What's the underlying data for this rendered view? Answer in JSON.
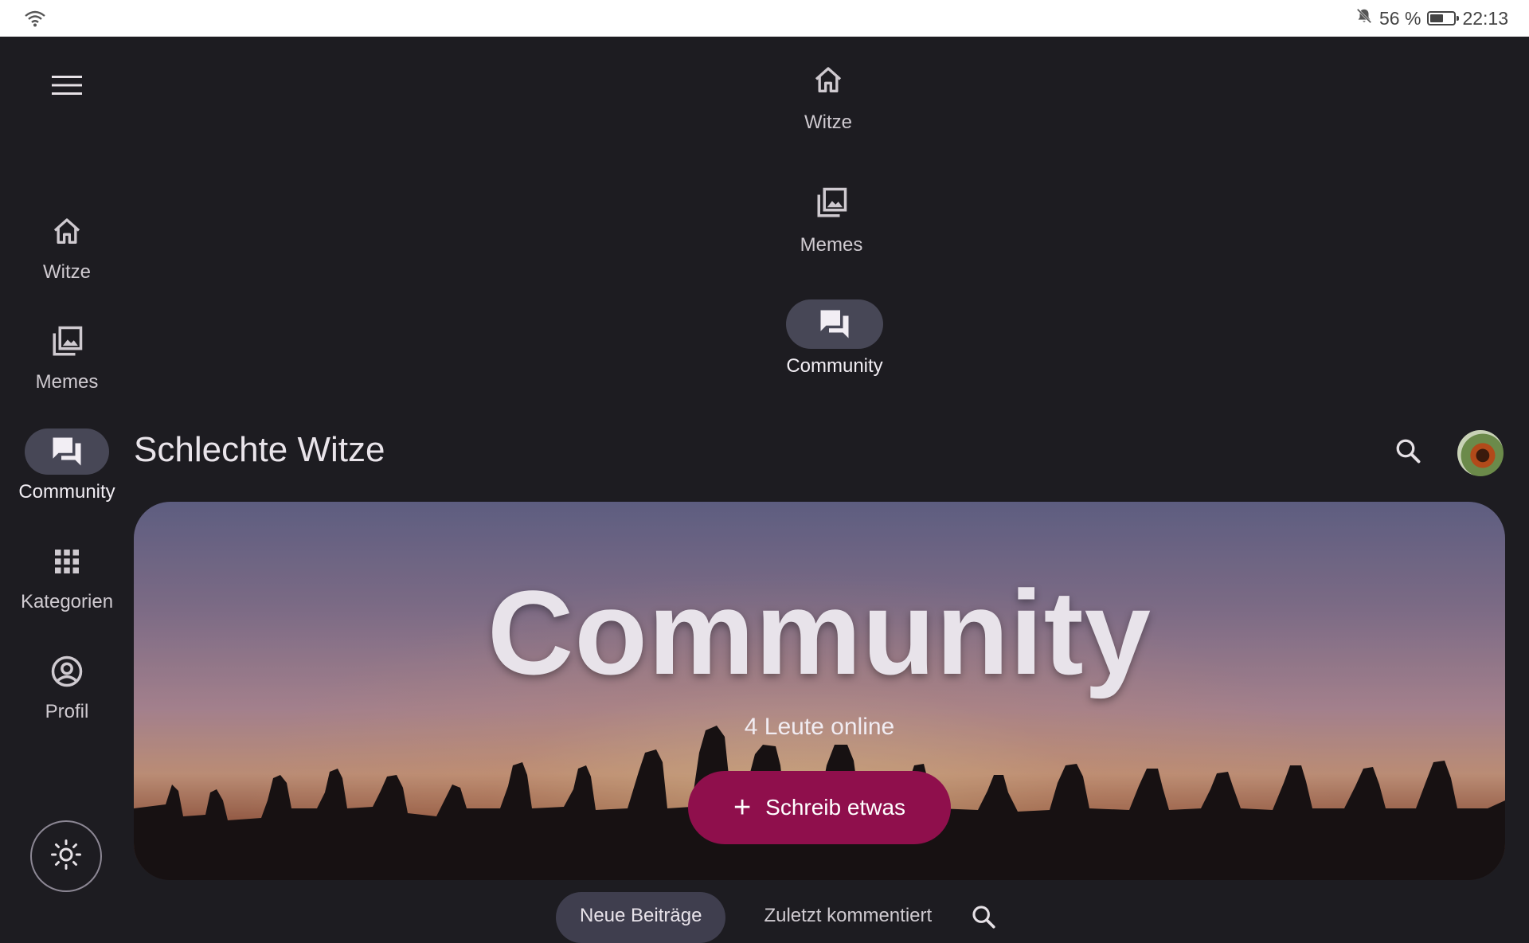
{
  "status_bar": {
    "battery_text": "56 %",
    "battery_level": 0.56,
    "time": "22:13",
    "icons": [
      "wifi-icon",
      "bell-off-icon",
      "battery-icon"
    ]
  },
  "rail": {
    "items": [
      {
        "label": "Witze",
        "icon": "home-icon",
        "active": false
      },
      {
        "label": "Memes",
        "icon": "image-gallery-icon",
        "active": false
      },
      {
        "label": "Community",
        "icon": "forum-icon",
        "active": true
      },
      {
        "label": "Kategorien",
        "icon": "grid-icon",
        "active": false
      },
      {
        "label": "Profil",
        "icon": "account-circle-icon",
        "active": false
      }
    ]
  },
  "top_nav": {
    "items": [
      {
        "label": "Witze",
        "icon": "home-icon",
        "active": false
      },
      {
        "label": "Memes",
        "icon": "image-gallery-icon",
        "active": false
      },
      {
        "label": "Community",
        "icon": "forum-icon",
        "active": true
      }
    ]
  },
  "header": {
    "title": "Schlechte Witze"
  },
  "hero": {
    "title": "Community",
    "subtitle": "4 Leute online",
    "cta_label": "Schreib etwas"
  },
  "tabs": {
    "items": [
      {
        "label": "Neue Beiträge",
        "active": true
      },
      {
        "label": "Zuletzt kommentiert",
        "active": false
      }
    ]
  },
  "colors": {
    "background": "#1d1c21",
    "active_indicator": "#474756",
    "cta": "#8f0f4c"
  }
}
